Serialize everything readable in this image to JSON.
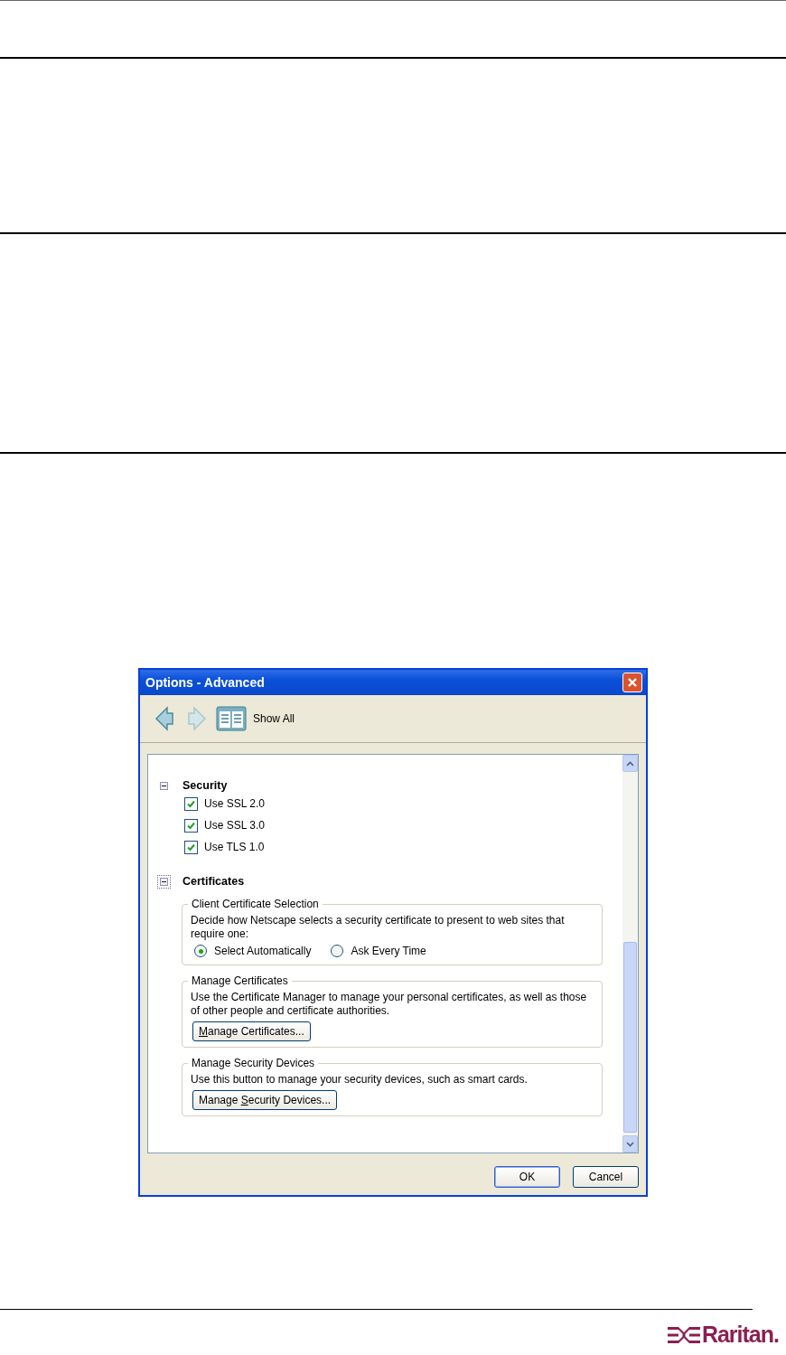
{
  "dialog": {
    "title": "Options - Advanced",
    "toolbar": {
      "show_all": "Show All"
    },
    "sections": [
      {
        "title": "Security",
        "expanded": true,
        "focused": false,
        "items": [
          {
            "label": "Use SSL 2.0",
            "checked": true
          },
          {
            "label": "Use SSL 3.0",
            "checked": true
          },
          {
            "label": "Use TLS 1.0",
            "checked": true
          }
        ]
      },
      {
        "title": "Certificates",
        "expanded": true,
        "focused": true,
        "groups": [
          {
            "kind": "radio",
            "legend": "Client Certificate Selection",
            "text": "Decide how Netscape selects a security certificate to present to web sites that require one:",
            "options": [
              {
                "label": "Select Automatically",
                "selected": true
              },
              {
                "label": "Ask Every Time",
                "selected": false
              }
            ]
          },
          {
            "kind": "button",
            "legend": "Manage Certificates",
            "text": "Use the Certificate Manager to manage your personal certificates, as well as those of other people and certificate authorities.",
            "button": {
              "key": "M",
              "after": "anage Certificates..."
            }
          },
          {
            "kind": "button",
            "legend": "Manage Security Devices",
            "text": "Use this button to manage your security devices, such as smart cards.",
            "button": {
              "before": "Manage ",
              "key": "S",
              "after": "ecurity Devices..."
            }
          }
        ]
      }
    ],
    "buttons": [
      "OK",
      "Cancel"
    ]
  },
  "footer": {
    "brand": "Raritan."
  }
}
